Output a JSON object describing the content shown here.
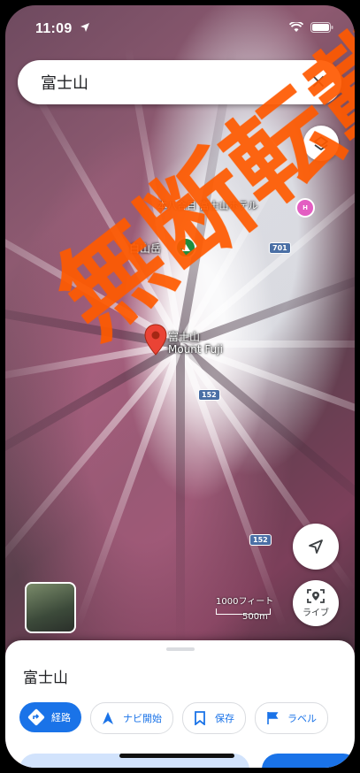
{
  "status_bar": {
    "time": "11:09"
  },
  "search": {
    "query": "富士山",
    "close_label": "×"
  },
  "map": {
    "poi_hotel": "本八合目 富士山ホテル",
    "poi_hotel_badge": "H",
    "poi_peak": "白山岳",
    "road_shields": [
      "701",
      "152",
      "152"
    ],
    "main_label_line1": "富士山",
    "main_label_line2": "Mount Fuji",
    "scale_top": "1000フィート",
    "scale_bottom": "500m"
  },
  "controls": {
    "live_label": "ライブ"
  },
  "sheet": {
    "title": "富士山",
    "chips": [
      {
        "label": "経路",
        "icon": "directions-icon",
        "style": "primary"
      },
      {
        "label": "ナビ開始",
        "icon": "navigation-arrow-icon",
        "style": "secondary"
      },
      {
        "label": "保存",
        "icon": "bookmark-icon",
        "style": "secondary"
      },
      {
        "label": "ラベル",
        "icon": "flag-icon",
        "style": "secondary"
      }
    ]
  },
  "watermark": {
    "text": "無断転載禁止"
  },
  "colors": {
    "accent": "#1a73e8",
    "pin": "#ea4335",
    "watermark": "#ff5a00"
  }
}
